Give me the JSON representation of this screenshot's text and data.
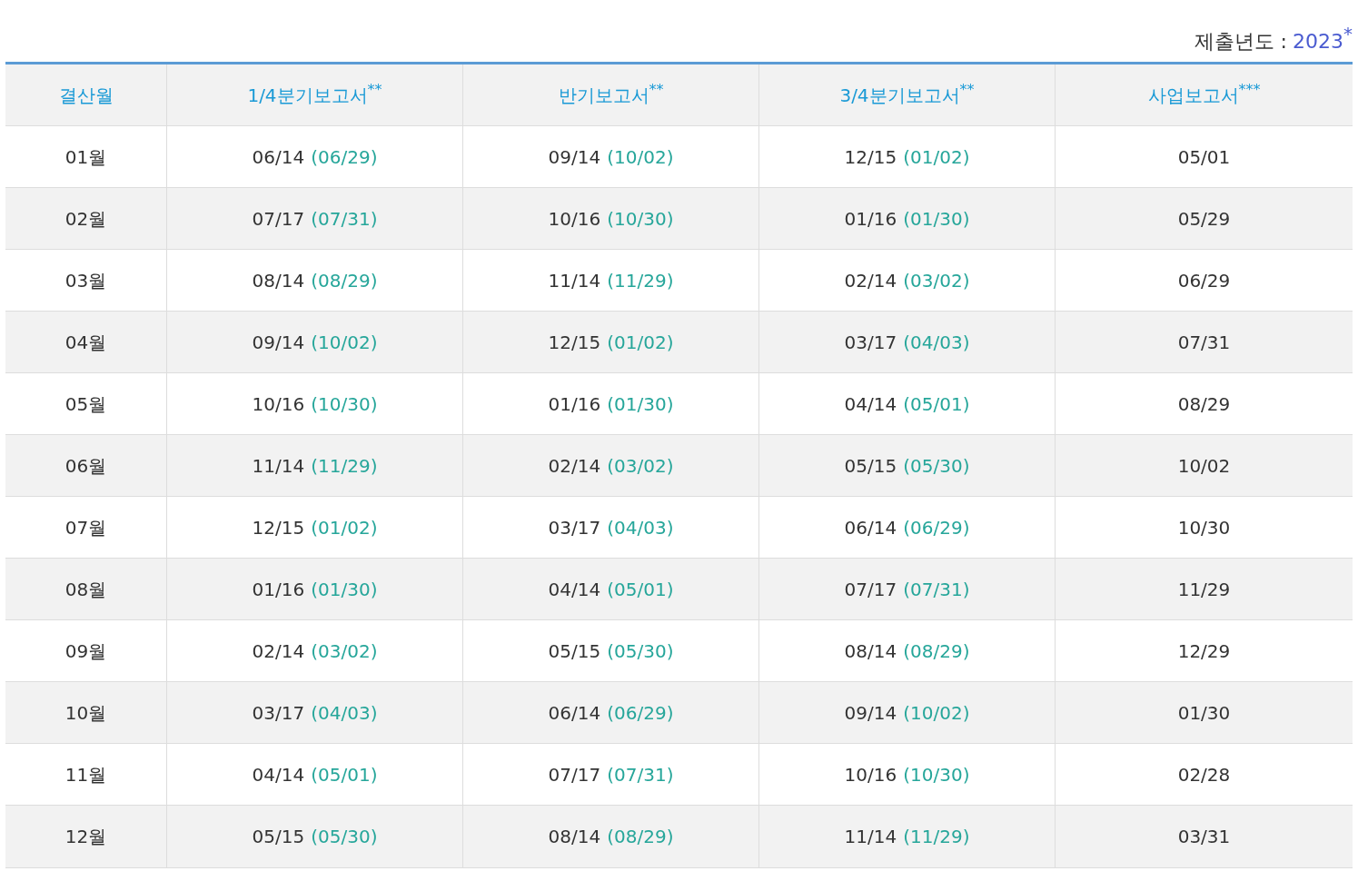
{
  "submission_year": {
    "label": "제출년도 :",
    "value": "2023",
    "mark": "*"
  },
  "table": {
    "columns": [
      "결산월",
      "1/4분기보고서$^{**}$",
      "반기보고서$^{**}$",
      "3/4분기보고서$^{**}$",
      "사업보고서$^{***}$"
    ],
    "rows": [
      [
        {
          "text": "01월"
        },
        {
          "text": "06/14",
          "deadline": "(06/29)"
        },
        {
          "text": "09/14",
          "deadline": "(10/02)"
        },
        {
          "text": "12/15",
          "deadline": "(01/02)"
        },
        {
          "text": "05/01"
        }
      ],
      [
        {
          "text": "02월"
        },
        {
          "text": "07/17",
          "deadline": "(07/31)"
        },
        {
          "text": "10/16",
          "deadline": "(10/30)"
        },
        {
          "text": "01/16",
          "deadline": "(01/30)"
        },
        {
          "text": "05/29"
        }
      ],
      [
        {
          "text": "03월"
        },
        {
          "text": "08/14",
          "deadline": "(08/29)"
        },
        {
          "text": "11/14",
          "deadline": "(11/29)"
        },
        {
          "text": "02/14",
          "deadline": "(03/02)"
        },
        {
          "text": "06/29"
        }
      ],
      [
        {
          "text": "04월"
        },
        {
          "text": "09/14",
          "deadline": "(10/02)"
        },
        {
          "text": "12/15",
          "deadline": "(01/02)"
        },
        {
          "text": "03/17",
          "deadline": "(04/03)"
        },
        {
          "text": "07/31"
        }
      ],
      [
        {
          "text": "05월"
        },
        {
          "text": "10/16",
          "deadline": "(10/30)"
        },
        {
          "text": "01/16",
          "deadline": "(01/30)"
        },
        {
          "text": "04/14",
          "deadline": "(05/01)"
        },
        {
          "text": "08/29"
        }
      ],
      [
        {
          "text": "06월"
        },
        {
          "text": "11/14",
          "deadline": "(11/29)"
        },
        {
          "text": "02/14",
          "deadline": "(03/02)"
        },
        {
          "text": "05/15",
          "deadline": "(05/30)"
        },
        {
          "text": "10/02"
        }
      ],
      [
        {
          "text": "07월"
        },
        {
          "text": "12/15",
          "deadline": "(01/02)"
        },
        {
          "text": "03/17",
          "deadline": "(04/03)"
        },
        {
          "text": "06/14",
          "deadline": "(06/29)"
        },
        {
          "text": "10/30"
        }
      ],
      [
        {
          "text": "08월"
        },
        {
          "text": "01/16",
          "deadline": "(01/30)"
        },
        {
          "text": "04/14",
          "deadline": "(05/01)"
        },
        {
          "text": "07/17",
          "deadline": "(07/31)"
        },
        {
          "text": "11/29"
        }
      ],
      [
        {
          "text": "09월"
        },
        {
          "text": "02/14",
          "deadline": "(03/02)"
        },
        {
          "text": "05/15",
          "deadline": "(05/30)"
        },
        {
          "text": "08/14",
          "deadline": "(08/29)"
        },
        {
          "text": "12/29"
        }
      ],
      [
        {
          "text": "10월"
        },
        {
          "text": "03/17",
          "deadline": "(04/03)"
        },
        {
          "text": "06/14",
          "deadline": "(06/29)"
        },
        {
          "text": "09/14",
          "deadline": "(10/02)"
        },
        {
          "text": "01/30"
        }
      ],
      [
        {
          "text": "11월"
        },
        {
          "text": "04/14",
          "deadline": "(05/01)"
        },
        {
          "text": "07/17",
          "deadline": "(07/31)"
        },
        {
          "text": "10/16",
          "deadline": "(10/30)"
        },
        {
          "text": "02/28"
        }
      ],
      [
        {
          "text": "12월"
        },
        {
          "text": "05/15",
          "deadline": "(05/30)"
        },
        {
          "text": "08/14",
          "deadline": "(08/29)"
        },
        {
          "text": "11/14",
          "deadline": "(11/29)"
        },
        {
          "text": "03/31"
        }
      ]
    ]
  }
}
